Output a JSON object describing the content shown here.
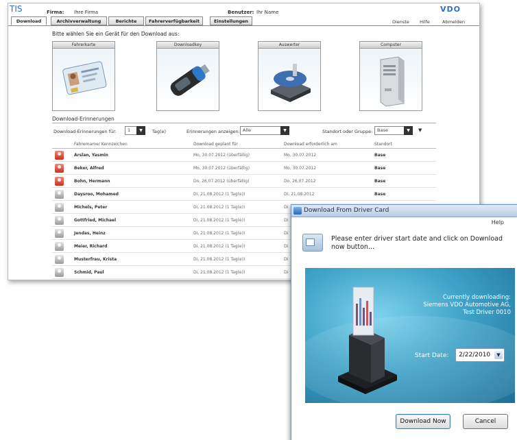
{
  "app": {
    "logo": "TIS",
    "firm_label": "Firma:",
    "firm_value": "Ihre Firma",
    "user_label": "Benutzer:",
    "user_value": "Ihr Name",
    "brand": "VDO"
  },
  "tabs": [
    {
      "label": "Download"
    },
    {
      "label": "Archivverwaltung"
    },
    {
      "label": "Berichte"
    },
    {
      "label": "Fahrerverfügbarkeit"
    },
    {
      "label": "Einstellungen"
    }
  ],
  "top_links": {
    "dienste": "Dienste",
    "hilfe": "Hilfe",
    "abmelden": "Abmelden"
  },
  "instruction": "Bitte wählen Sie ein Gerät für den Download aus:",
  "devices": [
    {
      "label": "Fahrerkarte",
      "icon": "driver-card-icon"
    },
    {
      "label": "Downloadkey",
      "icon": "download-key-icon"
    },
    {
      "label": "Auswerter",
      "icon": "disk-drive-icon"
    },
    {
      "label": "Computer",
      "icon": "computer-tower-icon"
    }
  ],
  "reminders": {
    "title": "Download-Erinnerungen",
    "filter_label": "Download-Erinnerungen für:",
    "filter_value": "1",
    "filter_unit": "Tag(e)",
    "show_label": "Erinnerungen anzeigen:",
    "show_value": "Alle",
    "location_label": "Standort oder Gruppe:",
    "location_value": "Base",
    "columns": [
      "Fahrername/ Kennzeichen",
      "Download geplant für",
      "Download erforderlich am",
      "Standort"
    ],
    "rows": [
      {
        "status": "red",
        "name": "Arslan, Yasmin",
        "planned": "Mo, 30.07.2012 (überfällig)",
        "required": "Mo, 30.07.2012",
        "location": "Base"
      },
      {
        "status": "red",
        "name": "Beker, Alfred",
        "planned": "Mo, 30.07.2012 (überfällig)",
        "required": "Mo, 30.07.2012",
        "location": "Base"
      },
      {
        "status": "red",
        "name": "Bohn, Hermann",
        "planned": "Do, 26.07.2012 (überfällig)",
        "required": "Do, 26.07.2012",
        "location": "Base"
      },
      {
        "status": "gray",
        "name": "Daysroo, Mohamed",
        "planned": "Di, 21.08.2012 (1 Tag(e))",
        "required": "Di, 21.08.2012",
        "location": "Base"
      },
      {
        "status": "gray",
        "name": "Michels, Peter",
        "planned": "Di, 21.08.2012 (1 Tag(e))",
        "required": "Di",
        "location": ""
      },
      {
        "status": "gray",
        "name": "Gottfried, Michael",
        "planned": "Di, 21.08.2012 (1 Tag(e))",
        "required": "Di",
        "location": ""
      },
      {
        "status": "gray",
        "name": "Jendas, Heinz",
        "planned": "Di, 21.08.2012 (1 Tag(e))",
        "required": "Di",
        "location": ""
      },
      {
        "status": "gray",
        "name": "Meier, Richard",
        "planned": "Di, 21.08.2012 (1 Tag(e))",
        "required": "Di",
        "location": ""
      },
      {
        "status": "gray",
        "name": "Musterfrau, Krista",
        "planned": "Di, 21.08.2012 (1 Tag(e))",
        "required": "Di",
        "location": ""
      },
      {
        "status": "gray",
        "name": "Schmid, Paul",
        "planned": "Di, 21.08.2012 (1 Tag(e))",
        "required": "Di",
        "location": ""
      }
    ]
  },
  "dialog": {
    "title": "Download From Driver Card",
    "help": "Help",
    "prompt": "Please enter driver start date and click on Download now button...",
    "downloading_line1": "Currently downloading:",
    "downloading_line2": "Siemens VDO Automotive AG,",
    "downloading_line3": "Test Driver 0010",
    "start_date_label": "Start Date:",
    "start_date_value": "2/22/2010",
    "download_button": "Download Now",
    "cancel_button": "Cancel"
  },
  "colors": {
    "accent": "#2f6fbf",
    "overdue": "#c8301e",
    "panel": "#3fa3c8"
  }
}
